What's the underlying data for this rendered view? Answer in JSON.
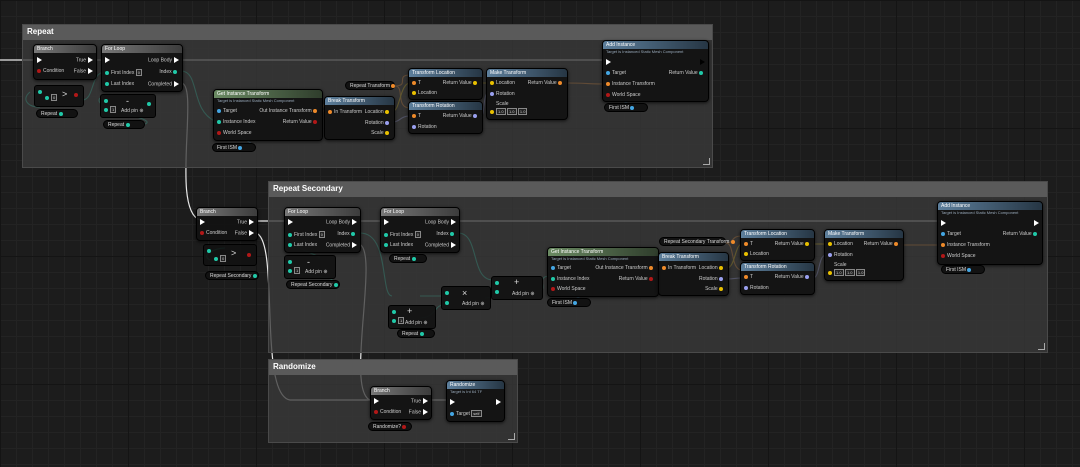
{
  "comments": {
    "repeat": "Repeat",
    "repeat_secondary": "Repeat Secondary",
    "randomize": "Randomize"
  },
  "labels": {
    "branch": "Branch",
    "for_loop": "For Loop",
    "true": "True",
    "false": "False",
    "condition": "Condition",
    "loop_body": "Loop Body",
    "first_index": "First Index",
    "last_index": "Last Index",
    "index": "Index",
    "completed": "Completed",
    "add_pin": "Add pin",
    "add_instance": "Add Instance",
    "add_instance_sub": "Target is Instanced Static Mesh Component",
    "target": "Target",
    "return_value": "Return Value",
    "instance_transform": "Instance Transform",
    "world_space": "World Space",
    "get_instance_transform": "Get Instance Transform",
    "get_instance_transform_sub": "Target is Instanced Static Mesh Component",
    "instance_index": "Instance Index",
    "out_instance_transform": "Out Instance Transform",
    "break_transform": "Break Transform",
    "in_transform": "In Transform",
    "location": "Location",
    "rotation": "Rotation",
    "scale": "Scale",
    "transform_location": "Transform Location",
    "transform_rotation": "Transform Rotation",
    "make_transform": "Make Transform",
    "t": "T",
    "randomize": "Randomize",
    "randomize_sub": "Target is Int 64 TF",
    "self": "self"
  },
  "vars": {
    "repeat": "Repeat",
    "repeat_secondary": "Repeat Secondary",
    "repeat_transform": "Repeat Transform",
    "repeat_secondary_transform": "Repeat Secondary Transform",
    "first_ism": "First ISM",
    "randomize_q": "Randomize?"
  },
  "values": {
    "zero": "0",
    "one_a": "1",
    "one_b": "1",
    "scale_x": "1.0",
    "scale_y": "1.0",
    "scale_z": "1.0",
    "gt": ">",
    "minus": "-",
    "times": "×",
    "plus": "+"
  }
}
